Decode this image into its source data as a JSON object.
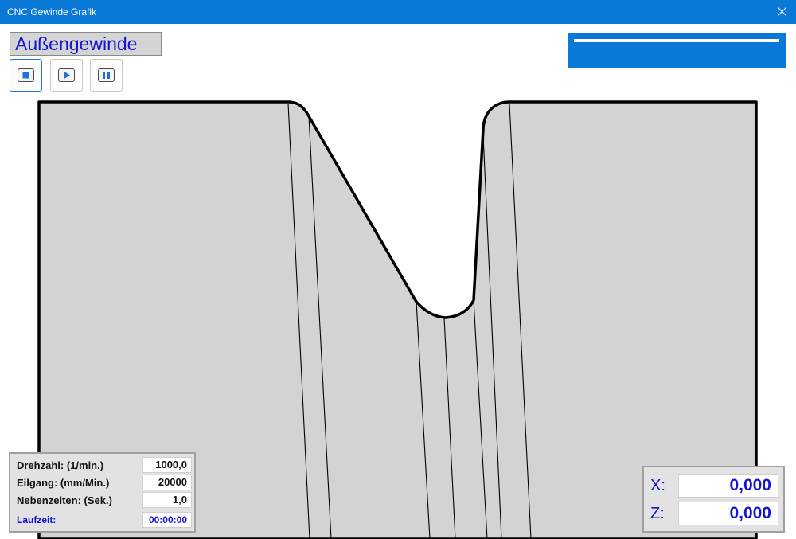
{
  "window": {
    "title": "CNC Gewinde Grafik",
    "close_icon": "close-icon"
  },
  "mode": {
    "label": "Außengewinde"
  },
  "toolbar": {
    "stop_icon": "stop-icon",
    "play_icon": "play-icon",
    "pause_icon": "pause-icon"
  },
  "info": {
    "rows": [
      {
        "label": "Drehzahl: (1/min.)",
        "value": "1000,0"
      },
      {
        "label": "Eilgang: (mm/Min.)",
        "value": "20000"
      },
      {
        "label": "Nebenzeiten: (Sek.)",
        "value": "1,0"
      },
      {
        "label": "Laufzeit:",
        "value": "00:00:00"
      }
    ]
  },
  "coords": {
    "x_label": "X:",
    "x_value": "0,000",
    "z_label": "Z:",
    "z_value": "0,000"
  },
  "colors": {
    "accent": "#0a78d7",
    "label_blue": "#1515d0",
    "workpiece_fill": "#d3d3d3"
  }
}
